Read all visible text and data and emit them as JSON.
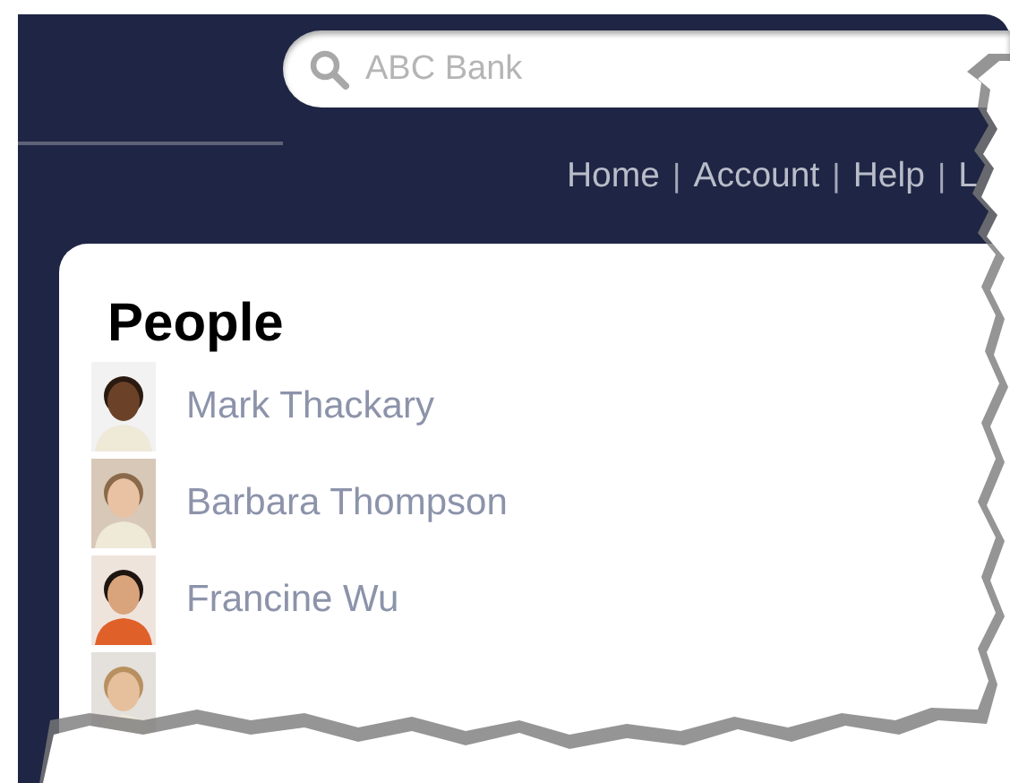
{
  "search": {
    "placeholder": "ABC Bank"
  },
  "nav": [
    {
      "kind": "link",
      "label": "Home"
    },
    {
      "kind": "separator",
      "label": "|"
    },
    {
      "kind": "link",
      "label": "Account"
    },
    {
      "kind": "separator",
      "label": "|"
    },
    {
      "kind": "link",
      "label": "Help"
    },
    {
      "kind": "separator",
      "label": "|"
    },
    {
      "kind": "link",
      "label": "L"
    }
  ],
  "people": {
    "title": "People",
    "items": [
      {
        "kind": "person",
        "name": "Mark Thackary"
      },
      {
        "kind": "person",
        "name": "Barbara Thompson"
      },
      {
        "kind": "person",
        "name": "Francine Wu"
      },
      {
        "kind": "cut-off"
      }
    ]
  }
}
